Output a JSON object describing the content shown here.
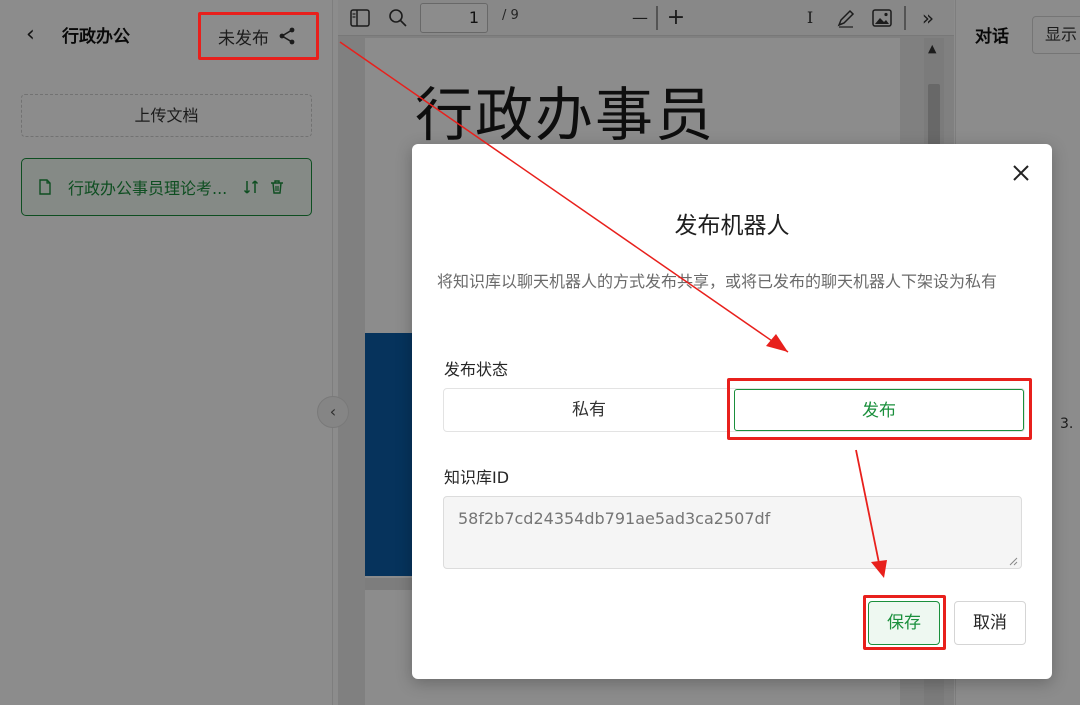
{
  "sidebar": {
    "title": "行政办公",
    "publish_state": "未发布",
    "upload_label": "上传文档",
    "document_name": "行政办公事员理论考..."
  },
  "viewer": {
    "page_number": "1",
    "page_total": "/ 9",
    "doc_heading": "行政办事员"
  },
  "chat": {
    "title": "对话",
    "show_label": "显示",
    "list_number": "3."
  },
  "modal": {
    "title": "发布机器人",
    "description": "将知识库以聊天机器人的方式发布共享，或将已发布的聊天机器人下架设为私有",
    "status_label": "发布状态",
    "options": [
      "私有",
      "发布"
    ],
    "selected_option": "发布",
    "id_label": "知识库ID",
    "id_value": "58f2b7cd24354db791ae5ad3ca2507df",
    "save_label": "保存",
    "cancel_label": "取消"
  },
  "colors": {
    "accent": "#1a8f3c",
    "annotation": "#e8201c",
    "doc_blue": "#0b5ea8"
  }
}
